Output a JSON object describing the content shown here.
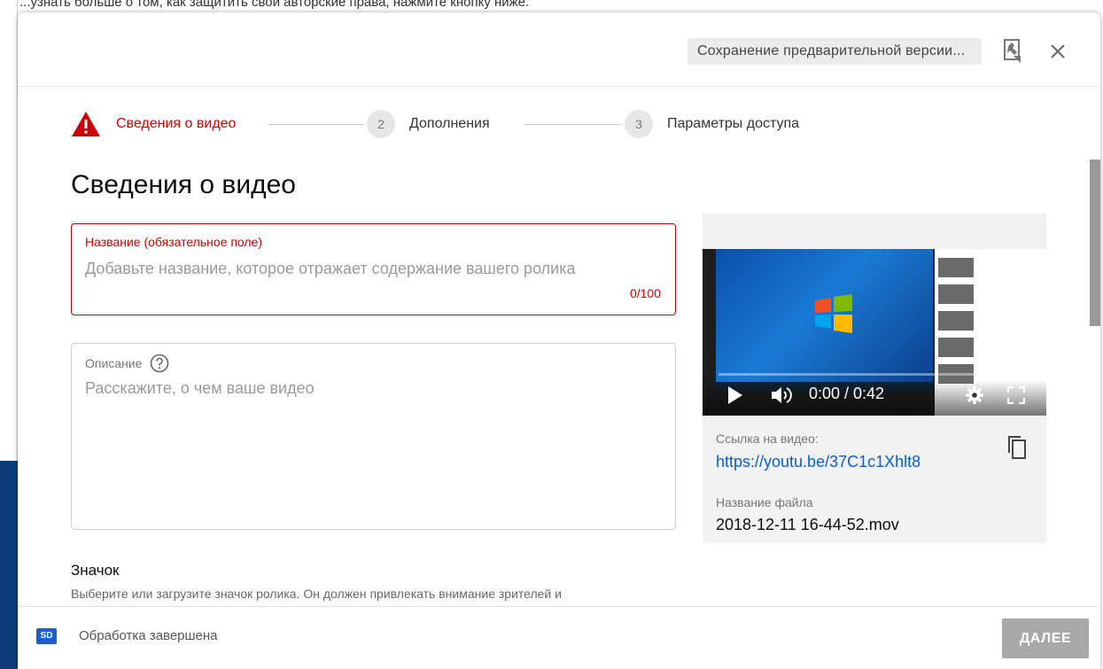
{
  "background": {
    "top_text": "...узнать больше о том, как защитить свои авторские права, нажмите кнопку ниже."
  },
  "header": {
    "save_status": "Сохранение предварительной версии...",
    "feedback_icon": "feedback-icon",
    "close_icon": "close-icon"
  },
  "stepper": {
    "steps": [
      {
        "number": "",
        "label": "Сведения о видео",
        "state": "error",
        "icon": "warning-icon"
      },
      {
        "number": "2",
        "label": "Дополнения",
        "state": "pending"
      },
      {
        "number": "3",
        "label": "Параметры доступа",
        "state": "pending"
      }
    ]
  },
  "main": {
    "title": "Сведения о видео",
    "title_field": {
      "label": "Название (обязательное поле)",
      "value": "",
      "placeholder": "Добавьте название, которое отражает содержание вашего ролика",
      "counter": "0/100"
    },
    "description_field": {
      "label": "Описание",
      "value": "",
      "placeholder": "Расскажите, о чем ваше видео"
    },
    "thumbnail": {
      "heading": "Значок",
      "description": "Выберите или загрузите значок ролика. Он должен привлекать внимание зрителей и"
    }
  },
  "preview": {
    "time": "0:00 / 0:42",
    "link_label": "Ссылка на видео:",
    "link_value": "https://youtu.be/37C1c1Xhlt8",
    "file_label": "Название файла",
    "file_value": "2018-12-11 16-44-52.mov"
  },
  "footer": {
    "quality_badge": "SD",
    "status": "Обработка завершена",
    "next_label": "ДАЛЕЕ"
  },
  "colors": {
    "error": "#cc0000",
    "link": "#065fd4",
    "disabled_button": "#a8a8a8",
    "badge": "#1a5dd1"
  }
}
